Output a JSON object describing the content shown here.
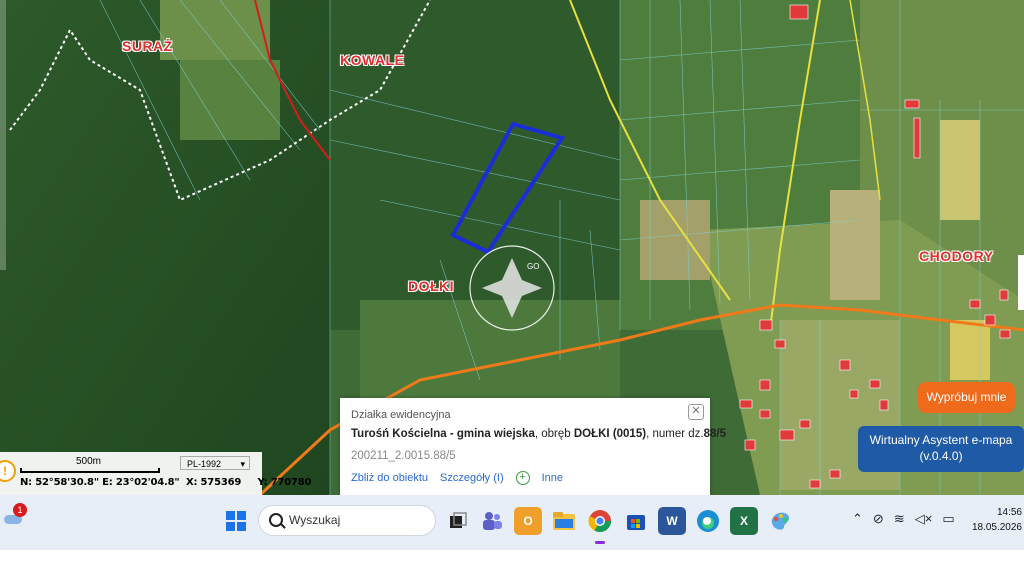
{
  "map": {
    "place_labels": [
      "SURAŻ",
      "KOWALE",
      "DOŁKI",
      "CHODORY"
    ],
    "compass_label": "GO"
  },
  "scale": {
    "scale_label": "500m",
    "projection": "PL-1992",
    "coords_text": "N: 52°58'30.8\" E: 23°02'04.8\"  X: 575369     Y: 770780"
  },
  "popup": {
    "title": "Działka ewidencyjna",
    "location_bold": "Turośń Kościelna - gmina wiejska",
    "obreb_prefix": ", obręb ",
    "obreb_bold": "DOŁKI (0015)",
    "numer_prefix": ", numer dz.",
    "numer_bold": "88/5",
    "code": "200211_2.0015.88/5",
    "link_zoom": "Zbliż do obiektu",
    "link_details": "Szczegóły (I)",
    "link_other": "Inne"
  },
  "buttons": {
    "try_me": "Wypróbuj mnie",
    "assistant_line1": "Wirtualny Asystent e-mapa",
    "assistant_line2": "(v.0.4.0)"
  },
  "taskbar": {
    "search_placeholder": "Wyszukaj",
    "weather_badge": "1",
    "time": "14:56",
    "date": "18.05.2026"
  }
}
